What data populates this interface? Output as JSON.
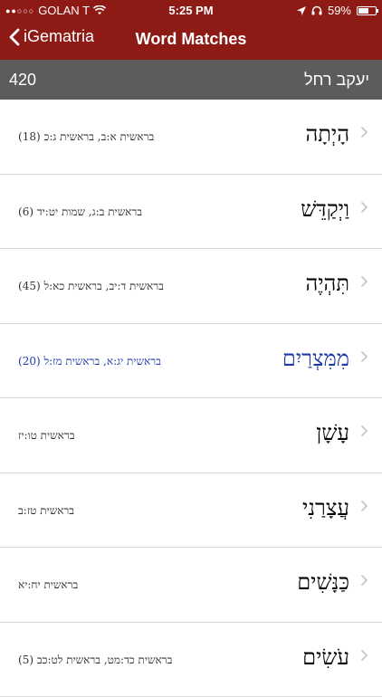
{
  "status": {
    "carrier": "GOLAN T",
    "time": "5:25 PM",
    "battery": "59%",
    "battery_level": 0.59
  },
  "nav": {
    "back_label": "iGematria",
    "title": "Word Matches"
  },
  "subheader": {
    "value": "420",
    "query": "יעקב רחל"
  },
  "rows": [
    {
      "word": "הָיְתָה",
      "refs": "בראשית א:ב, בראשית ג:כ (18)"
    },
    {
      "word": "וַיְקַדֵּשׁ",
      "refs": "בראשית ב:ג, שמות יט:יד (6)"
    },
    {
      "word": "תִּהְיֶה",
      "refs": "בראשית ד:יב, בראשית כא:ל (45)"
    },
    {
      "word": "מִמִּצְרַיִם",
      "refs": "בראשית יג:א, בראשית מז:ל (20)"
    },
    {
      "word": "עָשָׁן",
      "refs": "בראשית טו:יז"
    },
    {
      "word": "עֲצָרַנִי",
      "refs": "בראשית טז:ב"
    },
    {
      "word": "כַּנָּשִׁים",
      "refs": "בראשית יח:יא"
    },
    {
      "word": "עֹשִׂים",
      "refs": "בראשית כד:מט, בראשית לט:כב (5)"
    }
  ],
  "colors": {
    "header": "#8e1a15",
    "subheader": "#5c5c5c",
    "highlight": "#1e3aa8"
  }
}
